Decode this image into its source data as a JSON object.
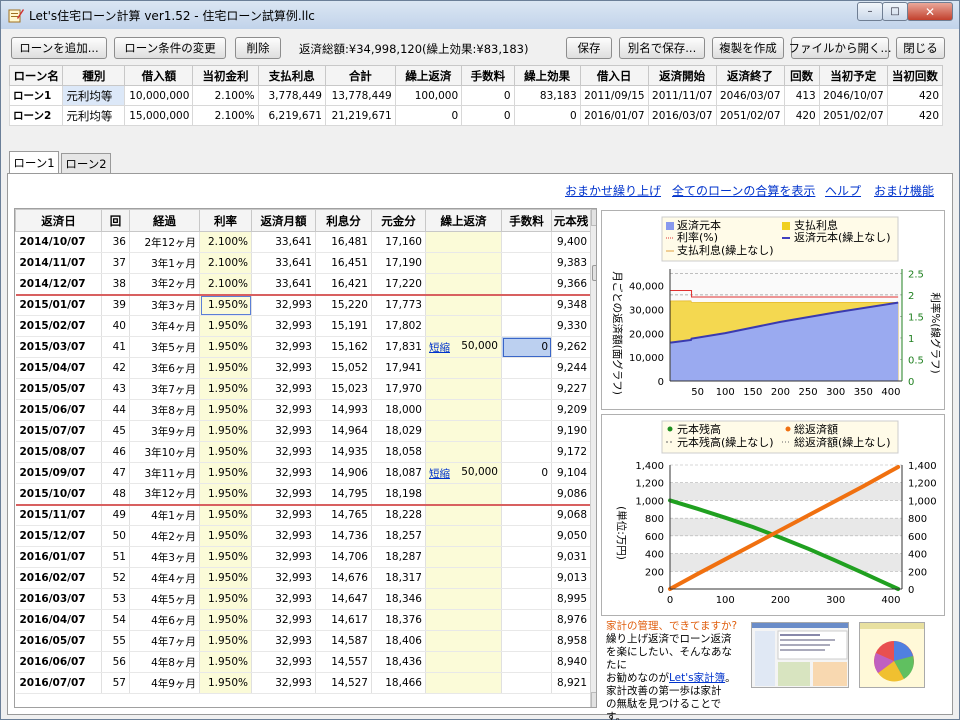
{
  "window": {
    "title": "Let's住宅ローン計算 ver1.52 - 住宅ローン試算例.llc",
    "min": "–",
    "max": "□",
    "close": "✕"
  },
  "toolbar": {
    "add_loan": "ローンを追加...",
    "change_loan": "ローン条件の変更",
    "delete": "削除",
    "summary": "返済総額:¥34,998,120(繰上効果:¥83,183)",
    "save": "保存",
    "save_as": "別名で保存...",
    "duplicate": "複製を作成",
    "open_file": "ファイルから開く...",
    "close": "閉じる"
  },
  "loans": {
    "headers": [
      "ローン名",
      "種別",
      "借入額",
      "当初金利",
      "支払利息",
      "合計",
      "繰上返済",
      "手数料",
      "繰上効果",
      "借入日",
      "返済開始",
      "返済終了",
      "回数",
      "当初予定",
      "当初回数"
    ],
    "rows": [
      [
        "ローン1",
        "元利均等",
        "10,000,000",
        "2.100%",
        "3,778,449",
        "13,778,449",
        "100,000",
        "0",
        "83,183",
        "2011/09/15",
        "2011/11/07",
        "2046/03/07",
        "413",
        "2046/10/07",
        "420"
      ],
      [
        "ローン2",
        "元利均等",
        "15,000,000",
        "2.100%",
        "6,219,671",
        "21,219,671",
        "0",
        "0",
        "0",
        "2016/01/07",
        "2016/03/07",
        "2051/02/07",
        "420",
        "2051/02/07",
        "420"
      ]
    ]
  },
  "tabs": [
    "ローン1",
    "ローン2"
  ],
  "links": [
    "おまかせ繰り上げ",
    "全てのローンの合算を表示",
    "ヘルプ",
    "おまけ機能"
  ],
  "schedule": {
    "headers": [
      "返済日",
      "回",
      "経過",
      "利率",
      "返済月額",
      "利息分",
      "元金分",
      "繰上返済",
      "手数料",
      "元本残"
    ],
    "rows": [
      [
        "2014/10/07",
        "36",
        "2年12ヶ月",
        "2.100%",
        "33,641",
        "16,481",
        "17,160",
        "",
        "",
        "9,400"
      ],
      [
        "2014/11/07",
        "37",
        "3年1ヶ月",
        "2.100%",
        "33,641",
        "16,451",
        "17,190",
        "",
        "",
        "9,383"
      ],
      [
        "2014/12/07",
        "38",
        "3年2ヶ月",
        "2.100%",
        "33,641",
        "16,421",
        "17,220",
        "",
        "",
        "9,366"
      ],
      [
        "2015/01/07",
        "39",
        "3年3ヶ月",
        "1.950%",
        "32,993",
        "15,220",
        "17,773",
        "",
        "",
        "9,348"
      ],
      [
        "2015/02/07",
        "40",
        "3年4ヶ月",
        "1.950%",
        "32,993",
        "15,191",
        "17,802",
        "",
        "",
        "9,330"
      ],
      [
        "2015/03/07",
        "41",
        "3年5ヶ月",
        "1.950%",
        "32,993",
        "15,162",
        "17,831",
        "短縮 50,000",
        "0",
        "9,262"
      ],
      [
        "2015/04/07",
        "42",
        "3年6ヶ月",
        "1.950%",
        "32,993",
        "15,052",
        "17,941",
        "",
        "",
        "9,244"
      ],
      [
        "2015/05/07",
        "43",
        "3年7ヶ月",
        "1.950%",
        "32,993",
        "15,023",
        "17,970",
        "",
        "",
        "9,227"
      ],
      [
        "2015/06/07",
        "44",
        "3年8ヶ月",
        "1.950%",
        "32,993",
        "14,993",
        "18,000",
        "",
        "",
        "9,209"
      ],
      [
        "2015/07/07",
        "45",
        "3年9ヶ月",
        "1.950%",
        "32,993",
        "14,964",
        "18,029",
        "",
        "",
        "9,190"
      ],
      [
        "2015/08/07",
        "46",
        "3年10ヶ月",
        "1.950%",
        "32,993",
        "14,935",
        "18,058",
        "",
        "",
        "9,172"
      ],
      [
        "2015/09/07",
        "47",
        "3年11ヶ月",
        "1.950%",
        "32,993",
        "14,906",
        "18,087",
        "短縮 50,000",
        "0",
        "9,104"
      ],
      [
        "2015/10/07",
        "48",
        "3年12ヶ月",
        "1.950%",
        "32,993",
        "14,795",
        "18,198",
        "",
        "",
        "9,086"
      ],
      [
        "2015/11/07",
        "49",
        "4年1ヶ月",
        "1.950%",
        "32,993",
        "14,765",
        "18,228",
        "",
        "",
        "9,068"
      ],
      [
        "2015/12/07",
        "50",
        "4年2ヶ月",
        "1.950%",
        "32,993",
        "14,736",
        "18,257",
        "",
        "",
        "9,050"
      ],
      [
        "2016/01/07",
        "51",
        "4年3ヶ月",
        "1.950%",
        "32,993",
        "14,706",
        "18,287",
        "",
        "",
        "9,031"
      ],
      [
        "2016/02/07",
        "52",
        "4年4ヶ月",
        "1.950%",
        "32,993",
        "14,676",
        "18,317",
        "",
        "",
        "9,013"
      ],
      [
        "2016/03/07",
        "53",
        "4年5ヶ月",
        "1.950%",
        "32,993",
        "14,647",
        "18,346",
        "",
        "",
        "8,995"
      ],
      [
        "2016/04/07",
        "54",
        "4年6ヶ月",
        "1.950%",
        "32,993",
        "14,617",
        "18,376",
        "",
        "",
        "8,976"
      ],
      [
        "2016/05/07",
        "55",
        "4年7ヶ月",
        "1.950%",
        "32,993",
        "14,587",
        "18,406",
        "",
        "",
        "8,958"
      ],
      [
        "2016/06/07",
        "56",
        "4年8ヶ月",
        "1.950%",
        "32,993",
        "14,557",
        "18,436",
        "",
        "",
        "8,940"
      ],
      [
        "2016/07/07",
        "57",
        "4年9ヶ月",
        "1.950%",
        "32,993",
        "14,527",
        "18,466",
        "",
        "",
        "8,921"
      ]
    ]
  },
  "chart_data": [
    {
      "type": "area",
      "legend": [
        "返済元本",
        "支払利息",
        "利率(%)",
        "返済元本(繰上なし)",
        "支払利息(繰上なし)"
      ],
      "legend_placement": "top",
      "ylabel": "月ごとの返済額(面グラフ)",
      "y2label": "利率%(線グラフ)",
      "xticks": [
        "50",
        "100",
        "150",
        "200",
        "250",
        "300",
        "350",
        "400"
      ],
      "yticks": [
        "0",
        "10,000",
        "20,000",
        "30,000",
        "40,000"
      ],
      "y2ticks": [
        "0",
        "0.5",
        "1",
        "1.5",
        "2",
        "2.5"
      ],
      "xlim": [
        0,
        420
      ],
      "ylim": [
        0,
        47000
      ],
      "y2lim": [
        0,
        2.6
      ],
      "x": [
        1,
        38,
        39,
        100,
        200,
        300,
        413
      ],
      "series": [
        {
          "name": "返済元本",
          "values": [
            16100,
            17220,
            17773,
            20100,
            24800,
            28800,
            32900
          ]
        },
        {
          "name": "支払利息",
          "values": [
            17500,
            16421,
            15220,
            12900,
            8200,
            4200,
            100
          ]
        },
        {
          "name": "利率(%)",
          "values": [
            2.1,
            2.1,
            1.95,
            1.95,
            1.95,
            1.95,
            1.95
          ]
        }
      ],
      "grid": true
    },
    {
      "type": "line",
      "legend": [
        "元本残高",
        "総返済額",
        "元本残高(繰上なし)",
        "総返済額(繰上なし)"
      ],
      "legend_placement": "top",
      "ylabel": "(単位:万円)",
      "xticks": [
        "0",
        "100",
        "200",
        "300",
        "400"
      ],
      "yticks": [
        "0",
        "200",
        "400",
        "600",
        "800",
        "1,000",
        "1,200",
        "1,400"
      ],
      "xlim": [
        0,
        420
      ],
      "ylim": [
        0,
        1400
      ],
      "x": [
        0,
        50,
        100,
        150,
        200,
        250,
        300,
        350,
        413
      ],
      "series": [
        {
          "name": "元本残高",
          "values": [
            1000,
            905,
            805,
            700,
            580,
            455,
            320,
            180,
            0
          ]
        },
        {
          "name": "総返済額",
          "values": [
            0,
            170,
            335,
            500,
            665,
            830,
            995,
            1160,
            1378
          ]
        }
      ],
      "grid": true
    }
  ],
  "ad": {
    "heading": "家計の管理、できてますか?",
    "line1": "繰り上げ返済でローン返済",
    "line2": "を楽にしたい、そんなあなたに",
    "line3_pre": "お勧めなのが",
    "link": "Let's家計簿",
    "line3_post": "。",
    "line4": "家計改善の第一歩は家計",
    "line5": "の無駄を見つけることです。"
  }
}
